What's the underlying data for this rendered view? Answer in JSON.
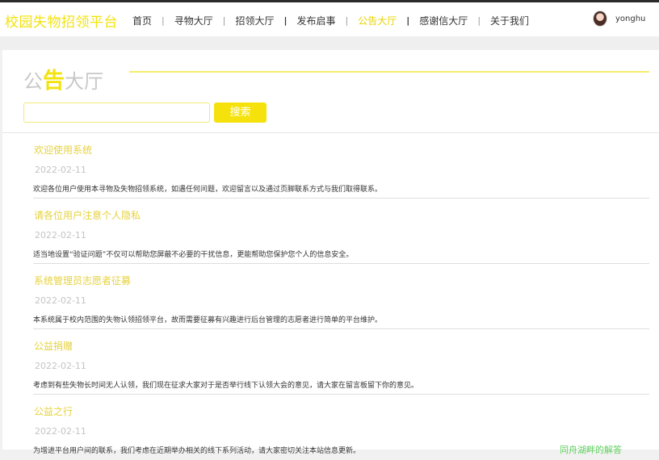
{
  "brand": "校园失物招领平台",
  "nav": {
    "items": [
      {
        "label": "首页"
      },
      {
        "label": "寻物大厅"
      },
      {
        "label": "招领大厅"
      },
      {
        "label": "发布启事"
      },
      {
        "label": "公告大厅"
      },
      {
        "label": "感谢信大厅"
      },
      {
        "label": "关于我们"
      }
    ],
    "active_index": 4,
    "active_color": "#e8d300"
  },
  "user": {
    "name": "yonghu",
    "avatar_icon": "user-avatar"
  },
  "page_title": {
    "part1": "公",
    "part2": "告",
    "part3": "大厅"
  },
  "search": {
    "placeholder": "",
    "value": "",
    "button_label": "搜索"
  },
  "announcements": [
    {
      "title": "欢迎使用系统",
      "date": "2022-02-11",
      "desc": "欢迎各位用户使用本寻物及失物招领系统，如遇任何问题，欢迎留言以及通过页脚联系方式与我们取得联系。"
    },
    {
      "title": "请各位用户注意个人隐私",
      "date": "2022-02-11",
      "desc": "适当地设置“验证问题”不仅可以帮助您屏蔽不必要的干扰信息，更能帮助您保护您个人的信息安全。"
    },
    {
      "title": "系统管理员志愿者征募",
      "date": "2022-02-11",
      "desc": "本系统属于校内范围的失物认领招领平台，故而需要征募有兴趣进行后台管理的志愿者进行简单的平台维护。"
    },
    {
      "title": "公益捐赠",
      "date": "2022-02-11",
      "desc": "考虑到有些失物长时间无人认领，我们现在征求大家对于是否举行线下认领大会的意见，请大家在留言板留下你的意见。"
    },
    {
      "title": "公益之行",
      "date": "2022-02-11",
      "desc": "为增进平台用户间的联系，我们考虑在近期举办相关的线下系列活动，请大家密切关注本站信息更新。"
    }
  ],
  "floating_tag": "同舟湖畔的解答",
  "colors": {
    "accent": "#f2e30c",
    "button": "#f5e20d",
    "date": "#c4c4c4"
  }
}
